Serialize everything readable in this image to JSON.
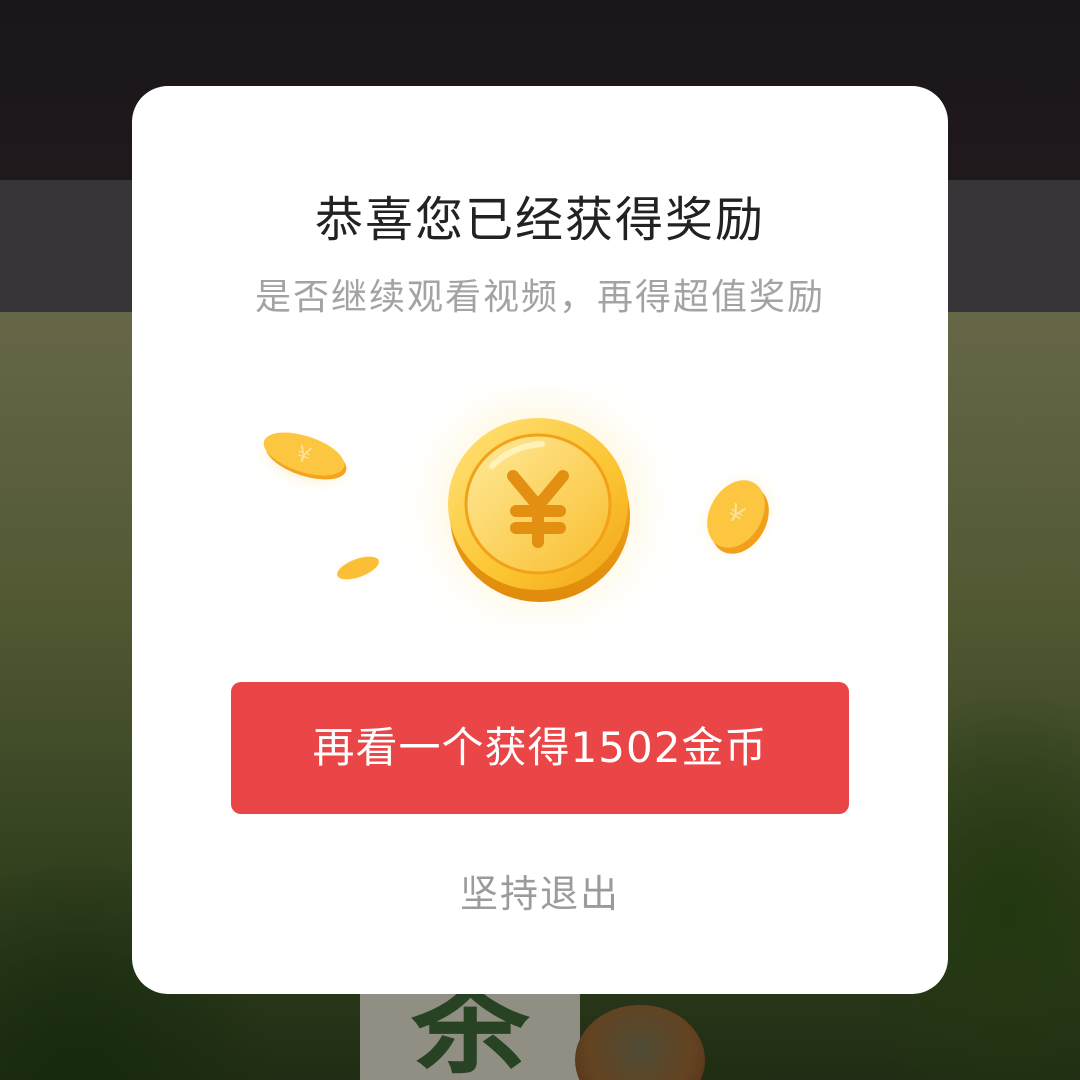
{
  "dialog": {
    "title": "恭喜您已经获得奖励",
    "subtitle": "是否继续观看视频，再得超值奖励",
    "primary_button_label": "再看一个获得1502金币",
    "exit_label": "坚持退出"
  },
  "coin": {
    "symbol": "¥",
    "icon": "gold-yuan-coin-icon"
  },
  "colors": {
    "button": "#ea4547",
    "title": "#222222",
    "subtitle": "#a3a3a3",
    "exit": "#9b9b9b",
    "coin_gold": "#f7b928"
  }
}
